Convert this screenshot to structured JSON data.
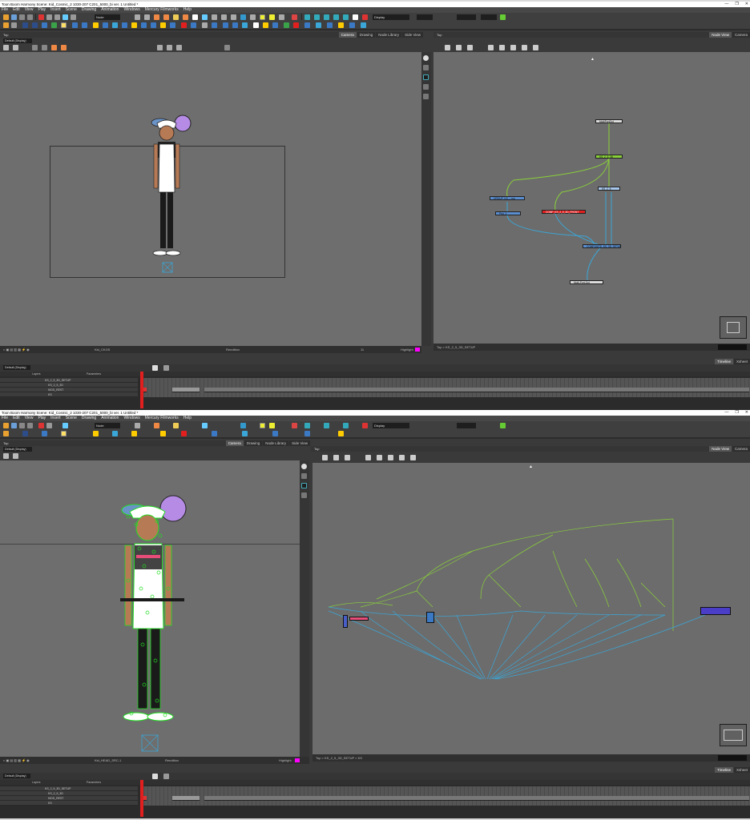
{
  "window_title": "Toon Boom Harmony Scene: Kid_Cosmic_2 1030-207 C201_5000_bi ver. 1 Untitled *",
  "window_controls": [
    "—",
    "❐",
    "✕"
  ],
  "menu": [
    "File",
    "Edit",
    "View",
    "Play",
    "Insert",
    "Scene",
    "Drawing",
    "Animation",
    "Windows",
    "Mercury Filmworks",
    "Help"
  ],
  "toolbar": {
    "view_select": "Node",
    "display_select": "Display"
  },
  "top": {
    "camera_view_select": "Default (Display)",
    "camera_breadcrumb": "Top",
    "camera_tabs": [
      "Camera",
      "Drawing",
      "Node Library",
      "Side View"
    ],
    "camera_status_drawing": "Kid_CKGS",
    "camera_status_mid": "Rendition",
    "camera_status_num": "11",
    "camera_status_right": "Highlight",
    "node_breadcrumb": "Top",
    "node_tabs": [
      "Node View",
      "Camera"
    ],
    "node_status": "Top > KS_2_5_3D_SETUP",
    "nodes": [
      {
        "label": "MultiPortOut",
        "color": "white"
      },
      {
        "label": "KS_2_5_3D",
        "color": "green"
      },
      {
        "label": "GROUP_KS_...mg",
        "color": "blue"
      },
      {
        "label": "Peg_1",
        "color": "blue"
      },
      {
        "label": "COMP_KS_2_5_3D_FRONT",
        "color": "red"
      },
      {
        "label": "KS_2_5",
        "color": "lblue"
      },
      {
        "label": "COMPOSITE_KS_3D_SETUP",
        "color": "blue"
      },
      {
        "label": "Multi-Port-Out",
        "color": "white"
      }
    ],
    "timeline_select": "Default (Display)",
    "timeline_tabs": [
      "Timeline",
      "Xsheet"
    ],
    "layer_col_header": "Layers",
    "params_header": "Parameters",
    "layers": [
      "KS_2_5_3D_SETUP",
      "KS_2_5_3D",
      "KIDS_REST",
      "KS"
    ]
  },
  "bottom": {
    "camera_view_select": "Default (Display)",
    "camera_breadcrumb": "Top",
    "camera_tabs": [
      "Camera",
      "Drawing",
      "Node Library",
      "Side View"
    ],
    "camera_status_drawing": "Kid_HEAD_SRC-1",
    "camera_status_mid": "Rendition",
    "camera_status_right": "Highlight",
    "node_breadcrumb": "Top",
    "node_tabs": [
      "Node View",
      "Camera"
    ],
    "node_status": "Top > KS_2_5_3D_SETUP > KS",
    "timeline_select": "Default (Display)",
    "timeline_tabs": [
      "Timeline",
      "Xsheet"
    ],
    "layer_col_header": "Layers",
    "params_header": "Parameters",
    "layers": [
      "KS_2_5_3D_SETUP",
      "KS_2_5_3D",
      "KIDS_REST",
      "KS"
    ]
  },
  "colors": {
    "accent_red": "#e21f1f",
    "node_green": "#8ad03a",
    "node_blue": "#5a8ed0",
    "highlight": "#ff00ff",
    "rig_green": "#22dd22",
    "wire_blue": "#3aa7d8"
  }
}
